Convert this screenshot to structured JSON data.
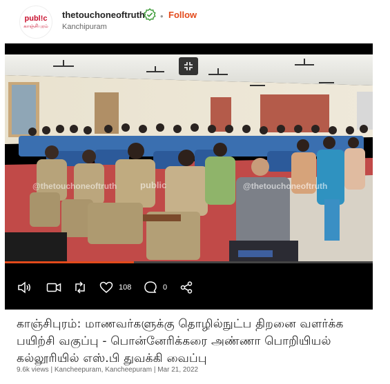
{
  "post": {
    "avatar": {
      "brand": "publ!c",
      "sub": "காஞ்சிபுரம்"
    },
    "username": "thetouchoneoftruth",
    "follow_label": "Follow",
    "location": "Kanchipuram"
  },
  "video": {
    "watermarks": [
      "@thetouchoneoftruth",
      "public",
      "@thetouchoneoftruth"
    ],
    "progress": 0.35,
    "brand_color": "#e34a1b"
  },
  "actions": {
    "volume_icon": "speaker-icon",
    "camera_icon": "video-camera-icon",
    "repost_icon": "repost-icon",
    "like_icon": "heart-icon",
    "like_count": "108",
    "comment_icon": "comment-icon",
    "comment_count": "0",
    "share_icon": "share-icon"
  },
  "title": "காஞ்சிபுரம்: மாணவர்களுக்கு தொழில்நுட்ப திறனை வளர்க்க பயிற்சி வகுப்பு - பொன்னேரிக்கரை அண்ணா பொறியியல் கல்லூரியில் எஸ்.பி துவக்கி வைப்பு",
  "meta": "9.6k views | Kancheepuram, Kancheepuram | Mar 21, 2022"
}
